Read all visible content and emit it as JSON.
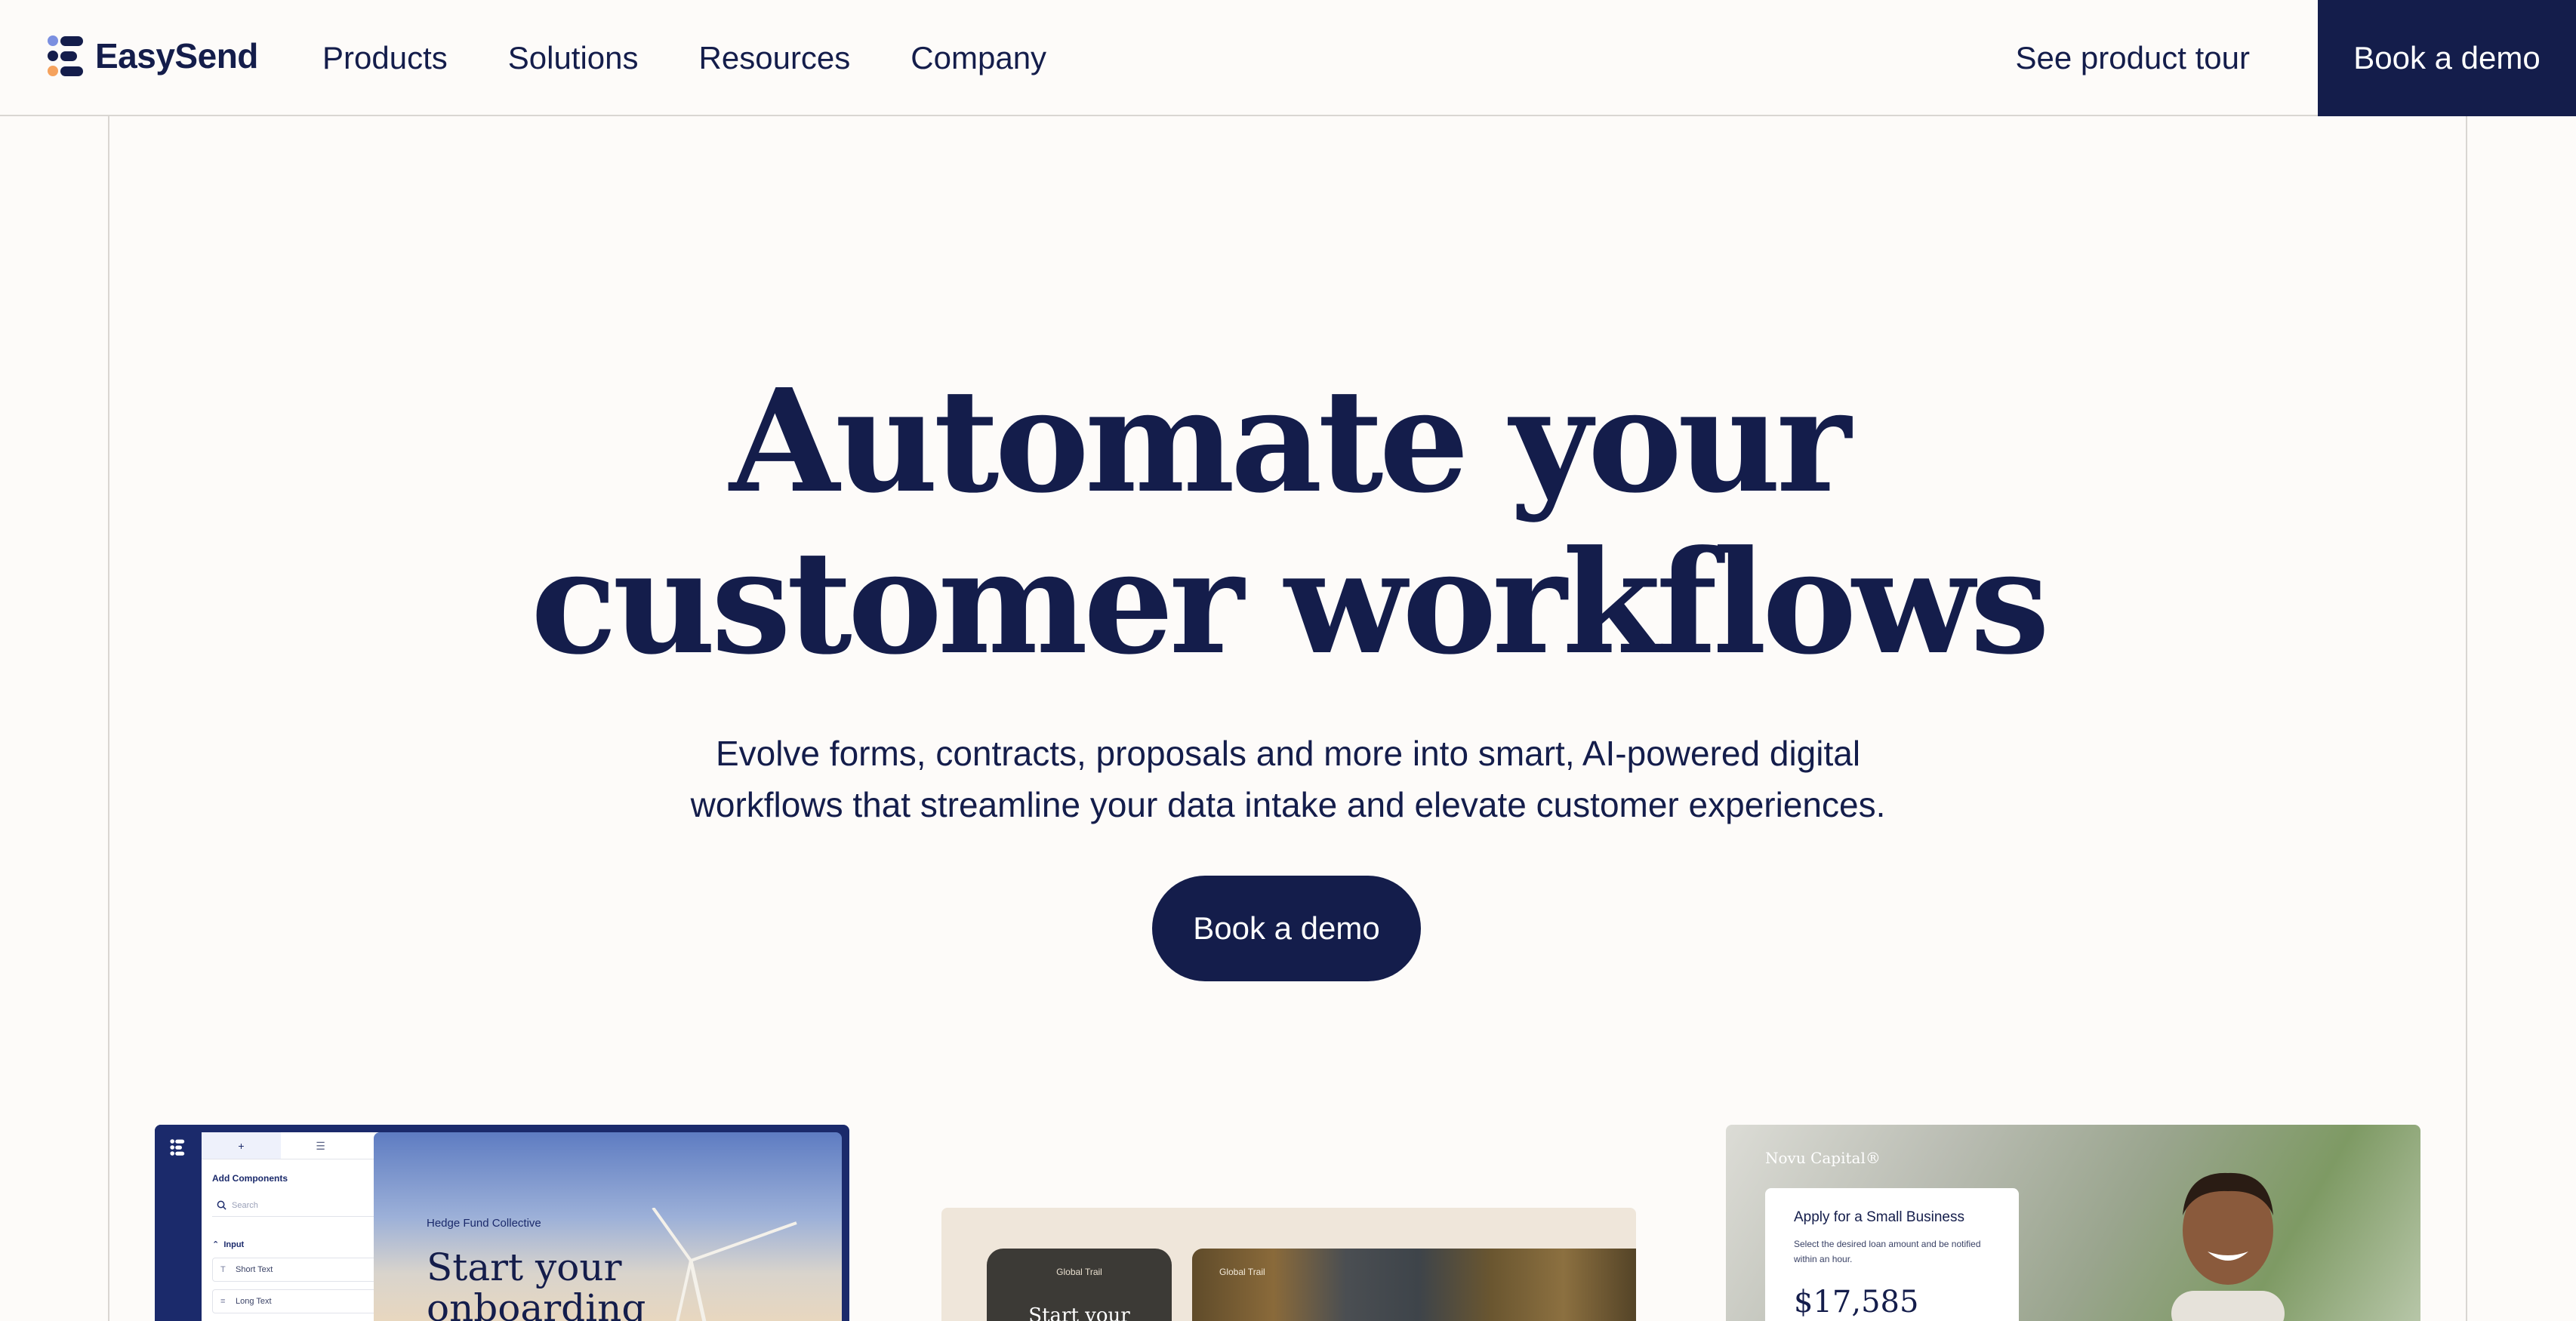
{
  "nav": {
    "brand": "EasySend",
    "links": [
      "Products",
      "Solutions",
      "Resources",
      "Company"
    ],
    "tour_label": "See product tour",
    "demo_label": "Book a demo"
  },
  "hero": {
    "title_line1": "Automate your",
    "title_line2": "customer workflows",
    "subtitle_line1": "Evolve forms, contracts, proposals and more into smart, AI-powered digital",
    "subtitle_line2": "workflows that streamline your data intake and elevate customer experiences.",
    "cta_label": "Book a demo"
  },
  "builder": {
    "panel_title": "Add Components",
    "search_placeholder": "Search",
    "group_label": "Input",
    "items": [
      "Short Text",
      "Long Text"
    ],
    "preview_org": "Hedge Fund Collective",
    "preview_headline_line1": "Start your",
    "preview_headline_line2": "onboarding"
  },
  "travel": {
    "phone_label": "Global Trail",
    "phone_headline": "Start your",
    "panel_label": "Global Trail"
  },
  "loan": {
    "brand": "Novu Capital®",
    "form_title": "Apply for a Small Business",
    "form_sub": "Select the desired loan amount and be notified within an hour.",
    "amount": "$17,585"
  },
  "colors": {
    "navy": "#141d4b",
    "background": "#fdfbf9",
    "logo_blue": "#7b8fe0",
    "logo_orange": "#f5a25d"
  }
}
